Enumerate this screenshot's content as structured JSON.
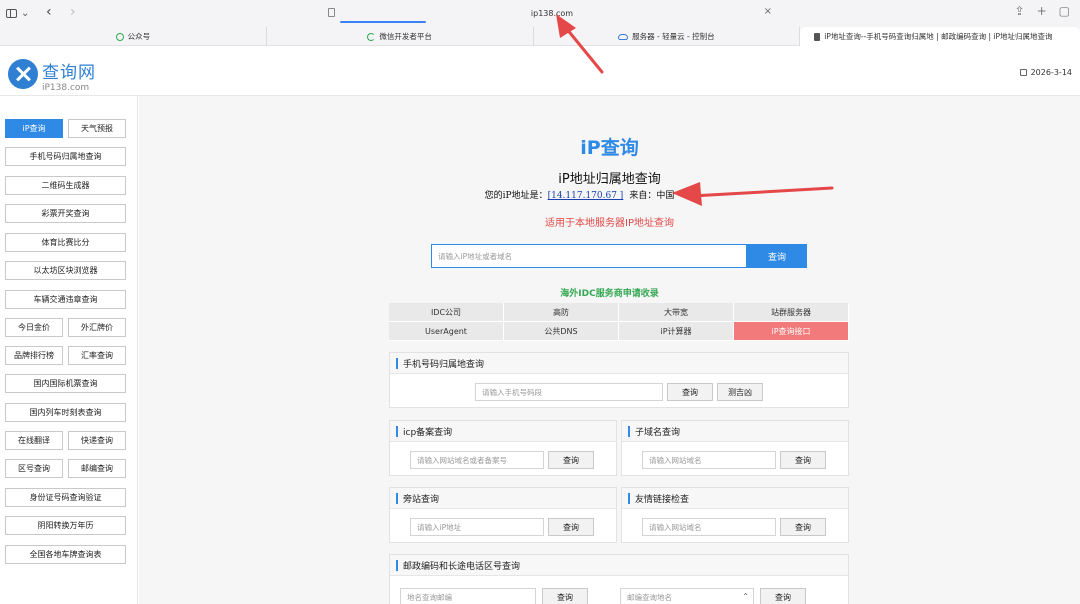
{
  "browser": {
    "address": "ip138.com",
    "bookmarks": [
      {
        "label": "公众号",
        "icon": "wechat-icon"
      },
      {
        "label": "微信开发者平台",
        "icon": "mini-program-icon"
      },
      {
        "label": "服务器 - 轻量云 - 控制台",
        "icon": "cloud-icon"
      },
      {
        "label": "iP地址查询--手机号码查询归属地 | 邮政编码查询 | iP地址归属地查询",
        "icon": "ip-icon"
      }
    ]
  },
  "header": {
    "logo_title": "查询网",
    "logo_sub": "iP138.com",
    "date": "2026-3-14"
  },
  "sidebar": {
    "items": [
      "iP查询",
      "天气预报",
      "手机号码归属地查询",
      "二维码生成器",
      "彩票开奖查询",
      "体育比赛比分",
      "以太坊区块浏览器",
      "车辆交通违章查询",
      "今日金价",
      "外汇牌价",
      "品牌排行榜",
      "汇率查询",
      "国内国际机票查询",
      "国内列车时刻表查询",
      "在线翻译",
      "快递查询",
      "区号查询",
      "邮编查询",
      "身份证号码查询验证",
      "阴阳转换万年历",
      "全国各地车牌查询表"
    ]
  },
  "hero": {
    "title": "iP查询",
    "subtitle": "iP地址归属地查询",
    "addr_prefix": "您的iP地址是：",
    "addr_ip": "[14.117.170.67 ]",
    "addr_from": "来自：中国",
    "note": "适用于本地服务器IP地址查询"
  },
  "search": {
    "placeholder": "请输入iP地址或者域名",
    "button": "查询"
  },
  "idc_title": "海外IDC服务商申请收录",
  "links": [
    "IDC公司",
    "高防",
    "大带宽",
    "站群服务器",
    "UserAgent",
    "公共DNS",
    "iP计算器",
    "iP查询接口"
  ],
  "panels": {
    "phone": {
      "title": "手机号码归属地查询",
      "placeholder": "请输入手机号码段",
      "btn1": "查询",
      "btn2": "测吉凶"
    },
    "icp": {
      "title": "icp备案查询",
      "placeholder": "请输入网站域名或者备案号",
      "btn": "查询"
    },
    "subdomain": {
      "title": "子域名查询",
      "placeholder": "请输入网站域名",
      "btn": "查询"
    },
    "sidesite": {
      "title": "旁站查询",
      "placeholder": "请输入iP地址",
      "btn": "查询"
    },
    "friendlink": {
      "title": "友情链接检查",
      "placeholder": "请输入网站域名",
      "btn": "查询"
    },
    "postal": {
      "title": "邮政编码和长途电话区号查询",
      "placeholder1": "地名查询邮编",
      "btn1": "查询",
      "placeholder2": "邮编查询地名",
      "btn2": "查询"
    }
  },
  "colors": {
    "accent": "#2f8ae5",
    "note_red": "#e04848",
    "idc_green": "#34a853",
    "hot_cell": "#f27a7a",
    "annotation": "#e54848"
  }
}
